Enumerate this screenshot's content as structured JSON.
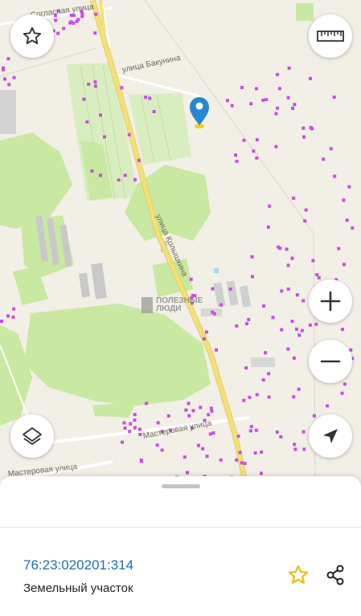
{
  "map": {
    "streets": [
      {
        "id": "soglasnaya",
        "label": "Согласная улица"
      },
      {
        "id": "bakunina",
        "label": "улица Бакунина"
      },
      {
        "id": "kolyshkina",
        "label": "улица Колышкина"
      },
      {
        "id": "masterovaya",
        "label": "Мастеровая улица"
      },
      {
        "id": "masterovaya2",
        "label": "Мастеровая улица"
      }
    ],
    "watermark": {
      "line1": "ПОЛЕЗНЫЕ",
      "line2": "ЛЮДИ"
    },
    "colors": {
      "background": "#f2efe6",
      "park": "#c9e8a1",
      "field": "#d9eec0",
      "main_road": "#f3e07a",
      "building": "#c9c9c9",
      "marker": "#2787d3",
      "dots": "#c64fe0"
    }
  },
  "controls": {
    "favorite_icon": "star-outline-icon",
    "ruler_icon": "ruler-icon",
    "zoom_in_icon": "plus-icon",
    "zoom_out_icon": "minus-icon",
    "layers_icon": "layers-icon",
    "location_icon": "navigation-arrow-icon"
  },
  "sheet": {
    "cadastral_number": "76:23:020201:314",
    "parcel_type": "Земельный участок",
    "favorite_icon": "star-icon",
    "share_icon": "share-icon",
    "star_color": "#e8c11d"
  }
}
